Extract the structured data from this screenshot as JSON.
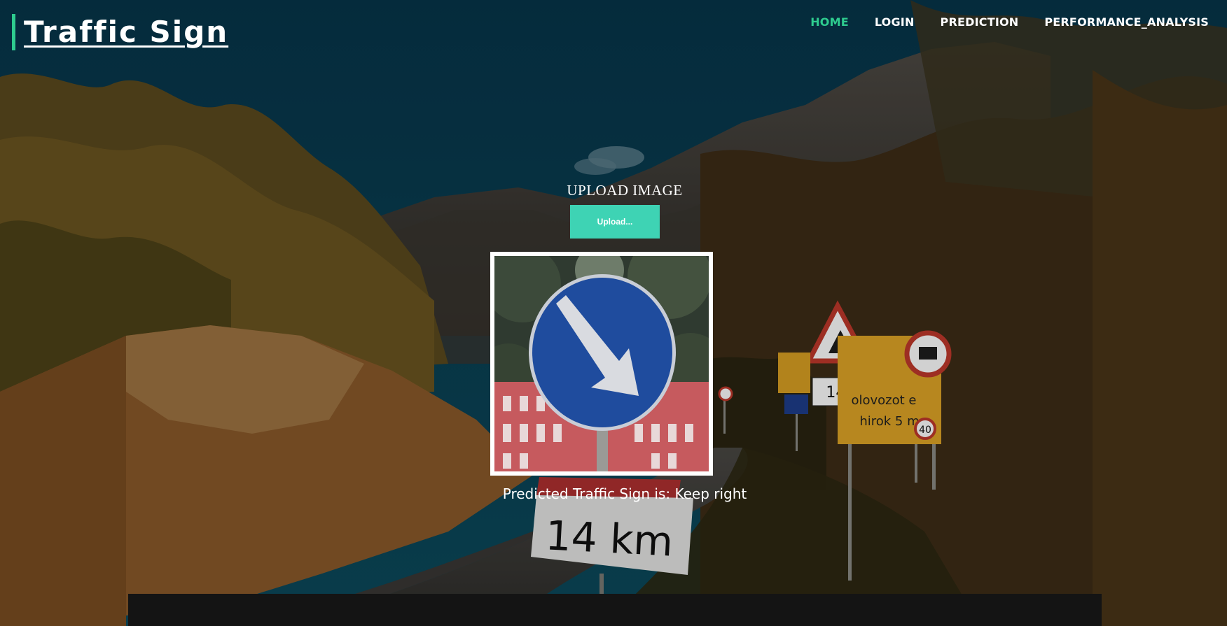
{
  "brand": {
    "title": "Traffic Sign",
    "accent_color": "#2ecc8f"
  },
  "nav": {
    "items": [
      {
        "label": "HOME",
        "active": true
      },
      {
        "label": "LOGIN",
        "active": false
      },
      {
        "label": "PREDICTION",
        "active": false
      },
      {
        "label": "PERFORMANCE_ANALYSIS",
        "active": false
      }
    ]
  },
  "upload": {
    "title": "UPLOAD IMAGE",
    "button_label": "Upload...",
    "button_color": "#3ed3b4"
  },
  "preview": {
    "image": "keep-right-sign",
    "prediction_text": "Predicted Traffic Sign is: Keep right"
  },
  "background": {
    "sign_text": "14 km",
    "speed_limit": "40"
  }
}
